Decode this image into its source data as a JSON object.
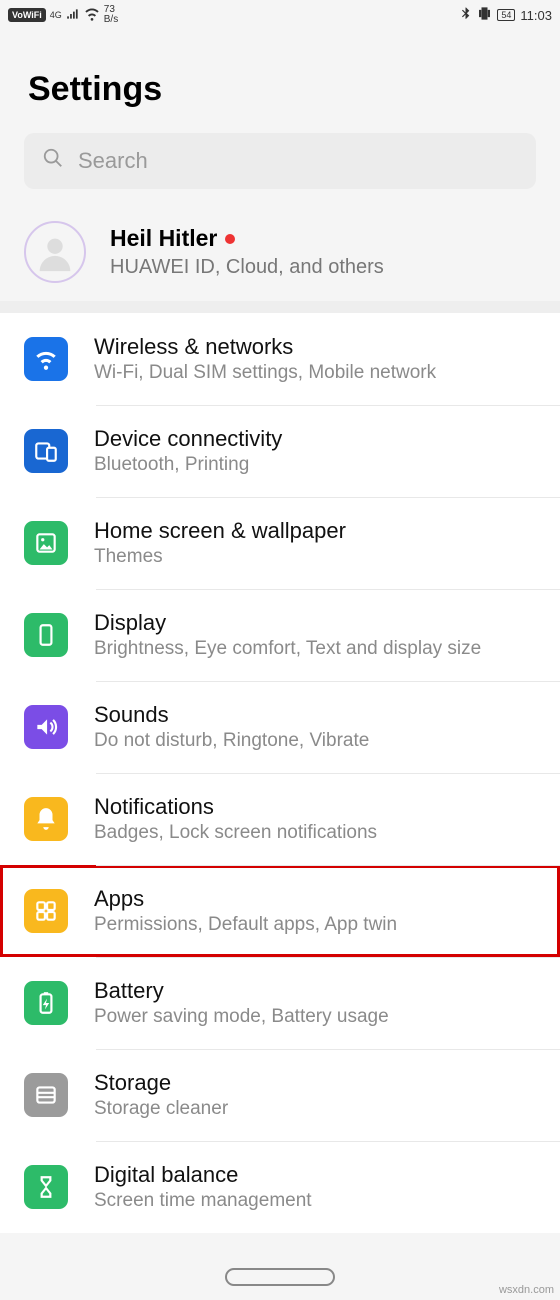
{
  "statusbar": {
    "vowifi": "VoWiFi",
    "net_label": "4G",
    "speed_val": "73",
    "speed_unit": "B/s",
    "battery": "54",
    "time": "11:03"
  },
  "page_title": "Settings",
  "search": {
    "placeholder": "Search"
  },
  "profile": {
    "name": "Heil Hitler",
    "subtitle": "HUAWEI ID, Cloud, and others"
  },
  "items": [
    {
      "title": "Wireless & networks",
      "subtitle": "Wi-Fi, Dual SIM settings, Mobile network",
      "icon": "wifi",
      "color": "bg-blue"
    },
    {
      "title": "Device connectivity",
      "subtitle": "Bluetooth, Printing",
      "icon": "devices",
      "color": "bg-blue2"
    },
    {
      "title": "Home screen & wallpaper",
      "subtitle": "Themes",
      "icon": "image",
      "color": "bg-green"
    },
    {
      "title": "Display",
      "subtitle": "Brightness, Eye comfort, Text and display size",
      "icon": "phone",
      "color": "bg-green2"
    },
    {
      "title": "Sounds",
      "subtitle": "Do not disturb, Ringtone, Vibrate",
      "icon": "sound",
      "color": "bg-purple"
    },
    {
      "title": "Notifications",
      "subtitle": "Badges, Lock screen notifications",
      "icon": "bell",
      "color": "bg-amber"
    },
    {
      "title": "Apps",
      "subtitle": "Permissions, Default apps, App twin",
      "icon": "grid",
      "color": "bg-amber2",
      "highlight": true
    },
    {
      "title": "Battery",
      "subtitle": "Power saving mode, Battery usage",
      "icon": "battery",
      "color": "bg-green3"
    },
    {
      "title": "Storage",
      "subtitle": "Storage cleaner",
      "icon": "storage",
      "color": "bg-grey"
    },
    {
      "title": "Digital balance",
      "subtitle": "Screen time management",
      "icon": "hourglass",
      "color": "bg-green4"
    }
  ],
  "watermark": "wsxdn.com"
}
